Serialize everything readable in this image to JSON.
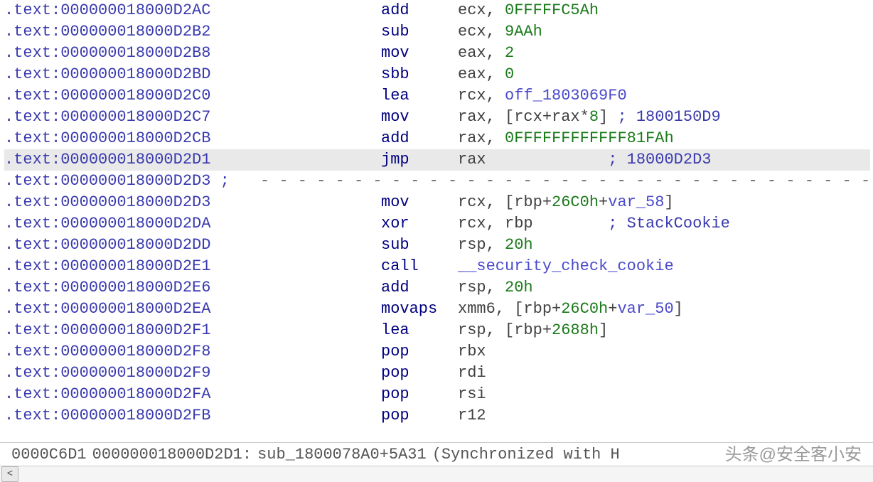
{
  "listing": {
    "rows": [
      {
        "addr": ".text:000000018000D2AC",
        "mnem": "add",
        "ops": [
          {
            "t": "reg",
            "v": "ecx"
          },
          {
            "t": "pn",
            "v": ", "
          },
          {
            "t": "num",
            "v": "0FFFFFC5Ah"
          }
        ]
      },
      {
        "addr": ".text:000000018000D2B2",
        "mnem": "sub",
        "ops": [
          {
            "t": "reg",
            "v": "ecx"
          },
          {
            "t": "pn",
            "v": ", "
          },
          {
            "t": "num",
            "v": "9AAh"
          }
        ]
      },
      {
        "addr": ".text:000000018000D2B8",
        "mnem": "mov",
        "ops": [
          {
            "t": "reg",
            "v": "eax"
          },
          {
            "t": "pn",
            "v": ", "
          },
          {
            "t": "num",
            "v": "2"
          }
        ]
      },
      {
        "addr": ".text:000000018000D2BD",
        "mnem": "sbb",
        "ops": [
          {
            "t": "reg",
            "v": "eax"
          },
          {
            "t": "pn",
            "v": ", "
          },
          {
            "t": "num",
            "v": "0"
          }
        ]
      },
      {
        "addr": ".text:000000018000D2C0",
        "mnem": "lea",
        "ops": [
          {
            "t": "reg",
            "v": "rcx"
          },
          {
            "t": "pn",
            "v": ", "
          },
          {
            "t": "sym",
            "v": "off_1803069F0"
          }
        ]
      },
      {
        "addr": ".text:000000018000D2C7",
        "mnem": "mov",
        "ops": [
          {
            "t": "reg",
            "v": "rax"
          },
          {
            "t": "pn",
            "v": ", ["
          },
          {
            "t": "reg",
            "v": "rcx"
          },
          {
            "t": "pn",
            "v": "+"
          },
          {
            "t": "reg",
            "v": "rax"
          },
          {
            "t": "pn",
            "v": "*"
          },
          {
            "t": "num",
            "v": "8"
          },
          {
            "t": "pn",
            "v": "] "
          },
          {
            "t": "cmt",
            "v": "; 1800150D9"
          }
        ]
      },
      {
        "addr": ".text:000000018000D2CB",
        "mnem": "add",
        "ops": [
          {
            "t": "reg",
            "v": "rax"
          },
          {
            "t": "pn",
            "v": ", "
          },
          {
            "t": "num",
            "v": "0FFFFFFFFFFFF81FAh"
          }
        ]
      },
      {
        "addr": ".text:000000018000D2D1",
        "mnem": "jmp",
        "sel": true,
        "ops": [
          {
            "t": "reg",
            "v": "rax"
          },
          {
            "t": "pad",
            "v": "             "
          },
          {
            "t": "cmt",
            "v": "; 18000D2D3"
          }
        ]
      },
      {
        "sep": true,
        "addr": ".text:000000018000D2D3",
        "sep_prefix": " ; "
      },
      {
        "addr": ".text:000000018000D2D3",
        "mnem": "mov",
        "ops": [
          {
            "t": "reg",
            "v": "rcx"
          },
          {
            "t": "pn",
            "v": ", ["
          },
          {
            "t": "reg",
            "v": "rbp"
          },
          {
            "t": "pn",
            "v": "+"
          },
          {
            "t": "num",
            "v": "26C0h"
          },
          {
            "t": "pn",
            "v": "+"
          },
          {
            "t": "sym",
            "v": "var_58"
          },
          {
            "t": "pn",
            "v": "]"
          }
        ]
      },
      {
        "addr": ".text:000000018000D2DA",
        "mnem": "xor",
        "ops": [
          {
            "t": "reg",
            "v": "rcx"
          },
          {
            "t": "pn",
            "v": ", "
          },
          {
            "t": "reg",
            "v": "rbp"
          },
          {
            "t": "pad",
            "v": "        "
          },
          {
            "t": "cmt",
            "v": "; StackCookie"
          }
        ]
      },
      {
        "addr": ".text:000000018000D2DD",
        "mnem": "sub",
        "ops": [
          {
            "t": "reg",
            "v": "rsp"
          },
          {
            "t": "pn",
            "v": ", "
          },
          {
            "t": "num",
            "v": "20h"
          }
        ]
      },
      {
        "addr": ".text:000000018000D2E1",
        "mnem": "call",
        "ops": [
          {
            "t": "sym",
            "v": "__security_check_cookie"
          }
        ]
      },
      {
        "addr": ".text:000000018000D2E6",
        "mnem": "add",
        "ops": [
          {
            "t": "reg",
            "v": "rsp"
          },
          {
            "t": "pn",
            "v": ", "
          },
          {
            "t": "num",
            "v": "20h"
          }
        ]
      },
      {
        "addr": ".text:000000018000D2EA",
        "mnem": "movaps",
        "ops": [
          {
            "t": "reg",
            "v": "xmm6"
          },
          {
            "t": "pn",
            "v": ", ["
          },
          {
            "t": "reg",
            "v": "rbp"
          },
          {
            "t": "pn",
            "v": "+"
          },
          {
            "t": "num",
            "v": "26C0h"
          },
          {
            "t": "pn",
            "v": "+"
          },
          {
            "t": "sym",
            "v": "var_50"
          },
          {
            "t": "pn",
            "v": "]"
          }
        ]
      },
      {
        "addr": ".text:000000018000D2F1",
        "mnem": "lea",
        "ops": [
          {
            "t": "reg",
            "v": "rsp"
          },
          {
            "t": "pn",
            "v": ", ["
          },
          {
            "t": "reg",
            "v": "rbp"
          },
          {
            "t": "pn",
            "v": "+"
          },
          {
            "t": "num",
            "v": "2688h"
          },
          {
            "t": "pn",
            "v": "]"
          }
        ]
      },
      {
        "addr": ".text:000000018000D2F8",
        "mnem": "pop",
        "ops": [
          {
            "t": "reg",
            "v": "rbx"
          }
        ]
      },
      {
        "addr": ".text:000000018000D2F9",
        "mnem": "pop",
        "ops": [
          {
            "t": "reg",
            "v": "rdi"
          }
        ]
      },
      {
        "addr": ".text:000000018000D2FA",
        "mnem": "pop",
        "ops": [
          {
            "t": "reg",
            "v": "rsi"
          }
        ]
      },
      {
        "addr": ".text:000000018000D2FB",
        "mnem": "pop",
        "ops": [
          {
            "t": "reg",
            "v": "r12"
          }
        ]
      }
    ]
  },
  "status": {
    "offset": "0000C6D1",
    "address": "000000018000D2D1:",
    "symbol": "sub_1800078A0+5A31",
    "sync": "(Synchronized with H"
  },
  "scroll": {
    "left_glyph": "<"
  },
  "watermark": "头条@安全客小安"
}
